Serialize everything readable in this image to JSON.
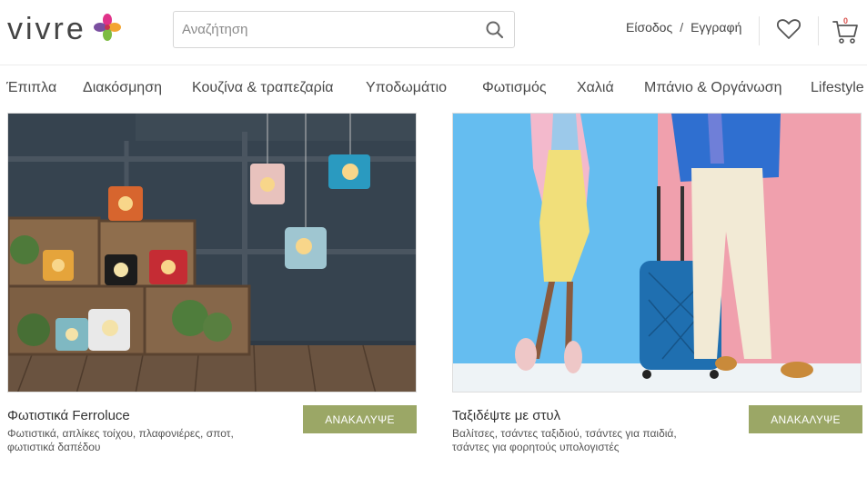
{
  "brand": {
    "name": "vivre"
  },
  "search": {
    "placeholder": "Αναζήτηση"
  },
  "account": {
    "login_label": "Είσοδος",
    "separator": "/",
    "register_label": "Εγγραφή"
  },
  "cart": {
    "count": "0"
  },
  "nav": {
    "items": [
      {
        "label": "Έπιπλα"
      },
      {
        "label": "Διακόσμηση"
      },
      {
        "label": "Κουζίνα & τραπεζαρία"
      },
      {
        "label": "Υποδωμάτιο"
      },
      {
        "label": "Φωτισμός"
      },
      {
        "label": "Χαλιά"
      },
      {
        "label": "Μπάνιο & Οργάνωση"
      },
      {
        "label": "Lifestyle"
      }
    ]
  },
  "promos": [
    {
      "title": "Φωτιστικά Ferroluce",
      "description": "Φωτιστικά, απλίκες τοίχου, πλαφονιέρες, σποτ, φωτιστικά δαπέδου",
      "cta_label": "ΑΝΑΚΑΛΥΨΕ"
    },
    {
      "title": "Ταξιδέψτε με στυλ",
      "description": "Βαλίτσες, τσάντες ταξιδιού, τσάντες για παιδιά, τσάντες για φορητούς υπολογιστές",
      "cta_label": "ΑΝΑΚΑΛΥΨΕ"
    }
  ],
  "colors": {
    "cta": "#9ba766",
    "cart_badge": "#d9534f"
  }
}
